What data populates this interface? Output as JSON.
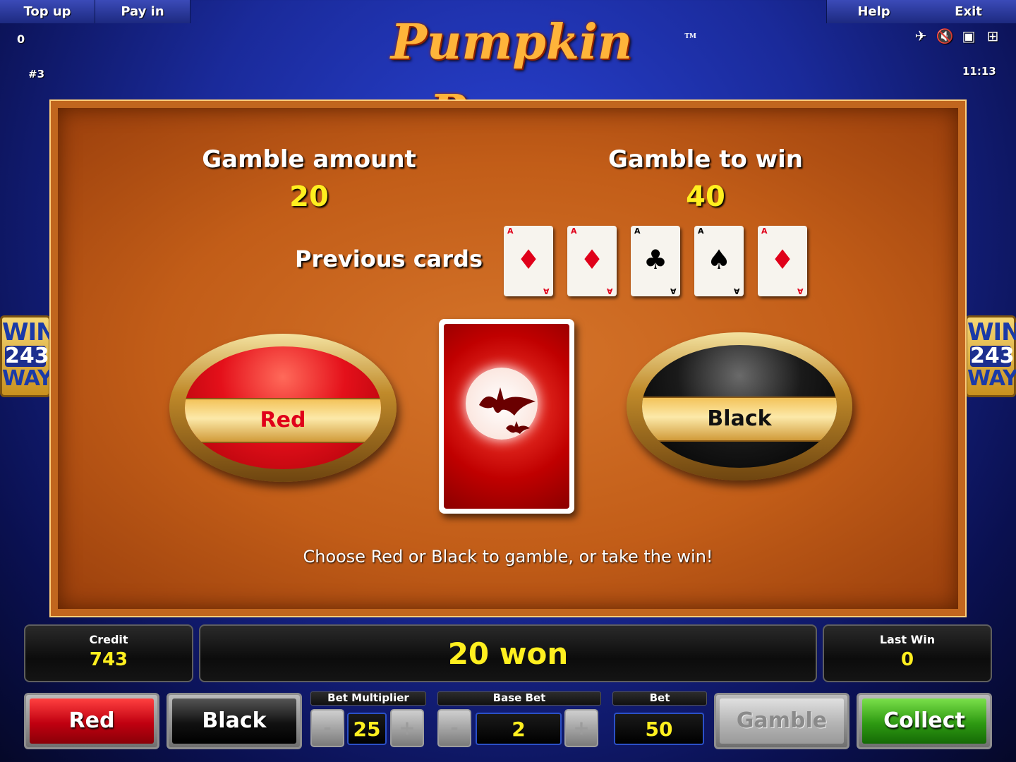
{
  "top_bar": {
    "top_up": "Top up",
    "pay_in": "Pay in",
    "help": "Help",
    "exit": "Exit",
    "balance_small": "0",
    "game_number": "#3",
    "clock": "11:13"
  },
  "title": "Pumpkin Power",
  "trademark": "TM",
  "side_badge": {
    "line1": "WIN",
    "line2": "243",
    "line3": "WAYS"
  },
  "gamble": {
    "amount_label": "Gamble amount",
    "amount_value": "20",
    "to_win_label": "Gamble to win",
    "to_win_value": "40",
    "previous_cards_label": "Previous cards",
    "previous_cards": [
      {
        "rank": "A",
        "suit": "♦",
        "color": "red"
      },
      {
        "rank": "A",
        "suit": "♦",
        "color": "red"
      },
      {
        "rank": "A",
        "suit": "♣",
        "color": "black"
      },
      {
        "rank": "A",
        "suit": "♠",
        "color": "black"
      },
      {
        "rank": "A",
        "suit": "♦",
        "color": "red"
      }
    ],
    "red_choice": "Red",
    "black_choice": "Black",
    "hint": "Choose Red or Black to gamble, or take the win!"
  },
  "status": {
    "credit_label": "Credit",
    "credit_value": "743",
    "message": "20 won",
    "last_win_label": "Last Win",
    "last_win_value": "0"
  },
  "controls": {
    "red_button": "Red",
    "black_button": "Black",
    "bet_multiplier_label": "Bet Multiplier",
    "bet_multiplier_value": "25",
    "base_bet_label": "Base Bet",
    "base_bet_value": "2",
    "bet_label": "Bet",
    "bet_value": "50",
    "minus": "-",
    "plus": "+",
    "gamble_button": "Gamble",
    "collect_button": "Collect"
  },
  "colors": {
    "accent_yellow": "#ffef1f",
    "panel_orange": "#c25d18",
    "collect_green": "#2e9a12",
    "red_button": "#d0101a"
  }
}
